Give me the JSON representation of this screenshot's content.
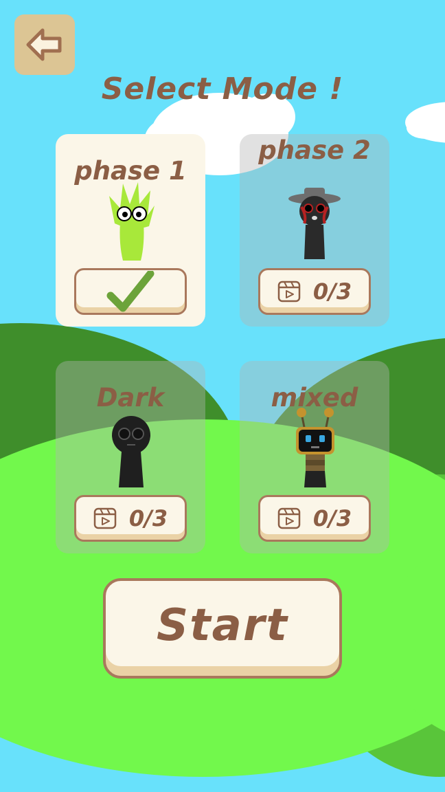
{
  "screen": {
    "title": "Select Mode !"
  },
  "modes": [
    {
      "label": "phase 1",
      "status": "selected",
      "progress": ""
    },
    {
      "label": "phase 2",
      "status": "locked",
      "progress": "0/3"
    },
    {
      "label": "Dark",
      "status": "locked",
      "progress": "0/3"
    },
    {
      "label": "mixed",
      "status": "locked",
      "progress": "0/3"
    }
  ],
  "actions": {
    "start_label": "Start"
  },
  "colors": {
    "sky": "#68e1fb",
    "grass": "#72f84c",
    "text_brown": "#8b5e45",
    "button_cream": "#fbf6e8",
    "back_button": "#dcc594",
    "check_green": "#6ca33a"
  },
  "icons": {
    "back": "arrow-left-icon",
    "selected": "checkmark-icon",
    "unlock": "video-play-icon"
  }
}
